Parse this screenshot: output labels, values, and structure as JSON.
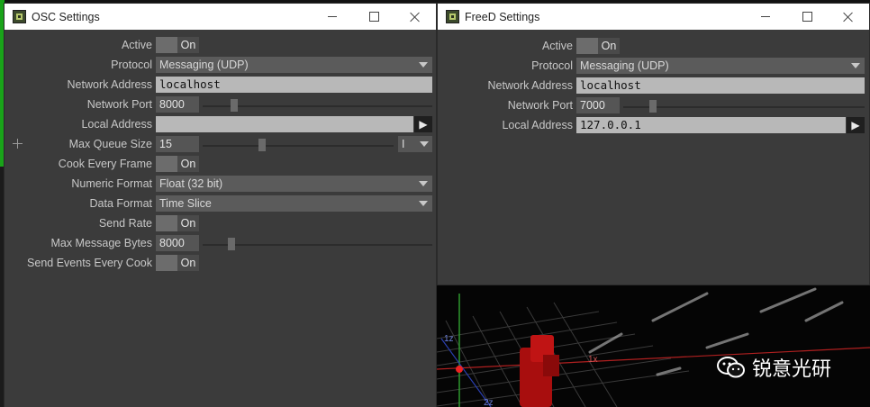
{
  "osc_window": {
    "title": "OSC Settings",
    "rows": {
      "active": {
        "label": "Active",
        "value": "On"
      },
      "protocol": {
        "label": "Protocol",
        "value": "Messaging (UDP)"
      },
      "network_address": {
        "label": "Network Address",
        "value": "localhost"
      },
      "network_port": {
        "label": "Network Port",
        "value": "8000"
      },
      "local_address": {
        "label": "Local Address",
        "value": ""
      },
      "max_queue_size": {
        "label": "Max Queue Size",
        "value": "15",
        "mode": "I"
      },
      "cook_every_frame": {
        "label": "Cook Every Frame",
        "value": "On"
      },
      "numeric_format": {
        "label": "Numeric Format",
        "value": "Float (32 bit)"
      },
      "data_format": {
        "label": "Data Format",
        "value": "Time Slice"
      },
      "send_rate": {
        "label": "Send Rate",
        "value": "On"
      },
      "max_message_bytes": {
        "label": "Max Message Bytes",
        "value": "8000"
      },
      "send_events_every_cook": {
        "label": "Send Events Every Cook",
        "value": "On"
      }
    }
  },
  "freed_window": {
    "title": "FreeD Settings",
    "rows": {
      "active": {
        "label": "Active",
        "value": "On"
      },
      "protocol": {
        "label": "Protocol",
        "value": "Messaging (UDP)"
      },
      "network_address": {
        "label": "Network Address",
        "value": "localhost"
      },
      "network_port": {
        "label": "Network Port",
        "value": "7000"
      },
      "local_address": {
        "label": "Local Address",
        "value": "127.0.0.1"
      }
    }
  },
  "viewport": {
    "axis_labels": {
      "z": "1z",
      "x": "1x",
      "z2": "2z"
    }
  },
  "watermark": {
    "text": "锐意光研"
  },
  "colors": {
    "window_bg": "#3b3b3b",
    "field_bg": "#b8b8b8",
    "dropdown_bg": "#5b5b5b",
    "green_accent": "#19a319",
    "viewport_red": "#cc1111"
  },
  "icons": {
    "play": "▶",
    "plus": "plus-icon"
  }
}
